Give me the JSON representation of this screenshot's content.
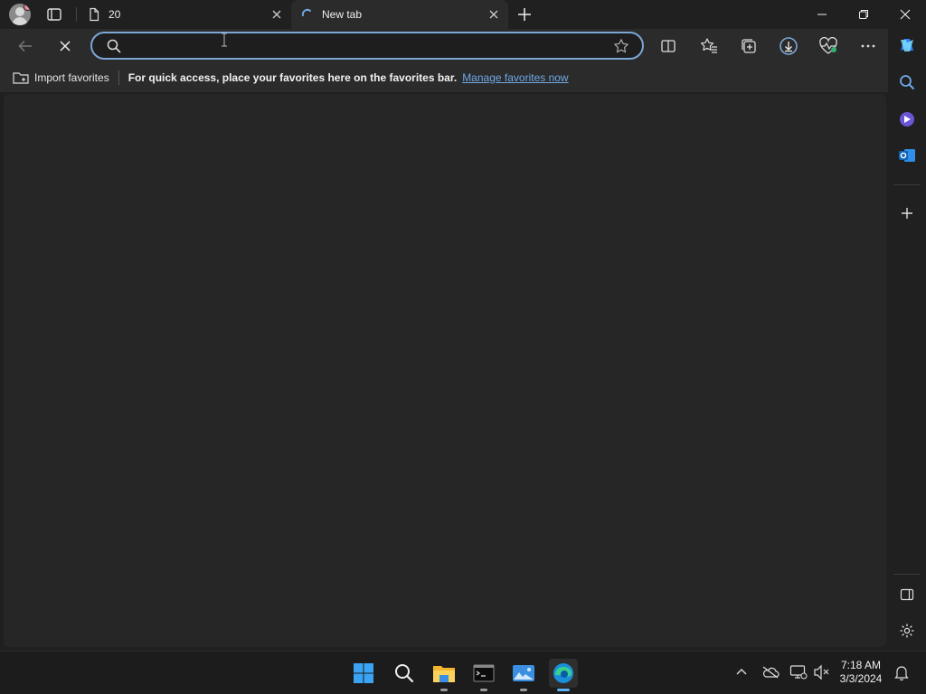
{
  "browser": {
    "tabs": [
      {
        "label": "20",
        "active": false
      },
      {
        "label": "New tab",
        "active": true
      }
    ]
  },
  "address_bar": {
    "value": "",
    "placeholder": ""
  },
  "favorites_bar": {
    "import_label": "Import favorites",
    "message": "For quick access, place your favorites here on the favorites bar.",
    "manage_link": "Manage favorites now"
  },
  "taskbar": {
    "time": "7:18 AM",
    "date": "3/3/2024"
  },
  "colors": {
    "accent": "#7aa7d6",
    "link": "#6fa8e6",
    "background": "#202020"
  }
}
